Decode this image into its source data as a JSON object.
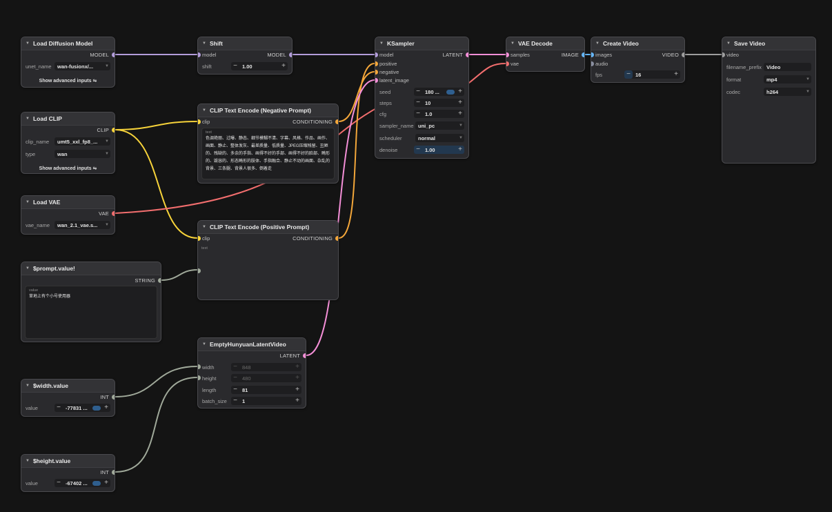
{
  "colors": {
    "model": "#b39ddb",
    "clip": "#f7d33a",
    "conditioning": "#f4a73a",
    "vae": "#f26e6e",
    "latent": "#f48fd7",
    "image": "#64b5f6",
    "video": "#9e9e9e",
    "string": "#a0a99a",
    "int": "#a0a99a"
  },
  "nodes": {
    "load_diffusion": {
      "title": "Load Diffusion Model",
      "out": "MODEL",
      "w_label": "unet_name",
      "w_value": "wan-fusionx/...",
      "adv": "Show advanced inputs"
    },
    "load_clip": {
      "title": "Load CLIP",
      "out": "CLIP",
      "w1_label": "clip_name",
      "w1_value": "umt5_xxl_fp8_...",
      "w2_label": "type",
      "w2_value": "wan",
      "adv": "Show advanced inputs"
    },
    "load_vae": {
      "title": "Load VAE",
      "out": "VAE",
      "w_label": "vae_name",
      "w_value": "wan_2.1_vae.s..."
    },
    "prompt": {
      "title": "$prompt.value!",
      "out": "STRING",
      "ta_label": "value",
      "ta_text": "草地上有个小号使用器"
    },
    "width_node": {
      "title": "$width.value",
      "out": "INT",
      "w_label": "value",
      "w_value": "-77831 ..."
    },
    "height_node": {
      "title": "$height.value",
      "out": "INT",
      "w_label": "value",
      "w_value": "-67402 ..."
    },
    "shift": {
      "title": "Shift",
      "in": "model",
      "out": "MODEL",
      "w_label": "shift",
      "w_value": "1.00"
    },
    "clip_neg": {
      "title": "CLIP Text Encode (Negative Prompt)",
      "in": "clip",
      "out": "CONDITIONING",
      "ta_label": "text",
      "ta_text": "色调艳丽、过曝、静态、细节模糊不清、字幕、风格、作品、画作、画面、静止、整体发灰、最差质量、低质量、JPEG压缩残留、丑陋的、残缺的、多余的手指、画得不好的手部、画得不好的脸部、畸形的、毁容的、形态畸形的肢体、手指融合、静止不动的画面、杂乱的背景、三条腿、背景人很多、倒着走"
    },
    "clip_pos": {
      "title": "CLIP Text Encode (Positive Prompt)",
      "in": "clip",
      "out": "CONDITIONING",
      "ta_label": "text",
      "ta_text": ""
    },
    "latent": {
      "title": "EmptyHunyuanLatentVideo",
      "out": "LATENT",
      "widgets": [
        {
          "label": "width",
          "value": "848",
          "disabled": true
        },
        {
          "label": "height",
          "value": "480",
          "disabled": true
        },
        {
          "label": "length",
          "value": "81",
          "disabled": false
        },
        {
          "label": "batch_size",
          "value": "1",
          "disabled": false
        }
      ]
    },
    "ksampler": {
      "title": "KSampler",
      "out": "LATENT",
      "inputs": [
        "model",
        "positive",
        "negative",
        "latent_image"
      ],
      "seed_label": "seed",
      "seed_value": "180 ...",
      "steps_label": "steps",
      "steps_value": "10",
      "cfg_label": "cfg",
      "cfg_value": "1.0",
      "sampler_label": "sampler_name",
      "sampler_value": "uni_pc",
      "scheduler_label": "scheduler",
      "scheduler_value": "normal",
      "denoise_label": "denoise",
      "denoise_value": "1.00"
    },
    "vae_decode": {
      "title": "VAE Decode",
      "in1": "samples",
      "in2": "vae",
      "out": "IMAGE"
    },
    "create_video": {
      "title": "Create Video",
      "in1": "images",
      "in2": "audio",
      "out": "VIDEO",
      "w_label": "fps",
      "w_value": "16"
    },
    "save_video": {
      "title": "Save Video",
      "in": "video",
      "w1_label": "filename_prefix",
      "w1_value": "Video",
      "w2_label": "format",
      "w2_value": "mp4",
      "w3_label": "codec",
      "w3_value": "h264"
    }
  }
}
